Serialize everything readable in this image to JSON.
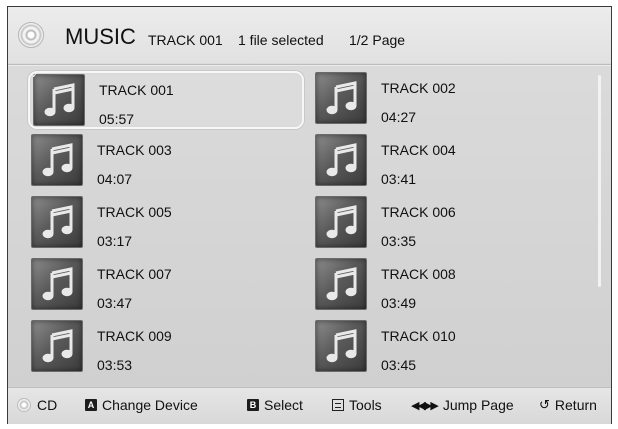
{
  "header": {
    "title": "MUSIC",
    "current_track": "TRACK 001",
    "selection_status": "1 file selected",
    "page_indicator": "1/2 Page"
  },
  "tracks": [
    {
      "name": "TRACK 001",
      "duration": "05:57",
      "selected": true
    },
    {
      "name": "TRACK 002",
      "duration": "04:27"
    },
    {
      "name": "TRACK 003",
      "duration": "04:07"
    },
    {
      "name": "TRACK 004",
      "duration": "03:41"
    },
    {
      "name": "TRACK 005",
      "duration": "03:17"
    },
    {
      "name": "TRACK 006",
      "duration": "03:35"
    },
    {
      "name": "TRACK 007",
      "duration": "03:47"
    },
    {
      "name": "TRACK 008",
      "duration": "03:49"
    },
    {
      "name": "TRACK 009",
      "duration": "03:53"
    },
    {
      "name": "TRACK 010",
      "duration": "03:45"
    }
  ],
  "footer": {
    "device": "CD",
    "change_device": {
      "key": "A",
      "label": "Change Device"
    },
    "select": {
      "key": "B",
      "label": "Select"
    },
    "tools": {
      "label": "Tools"
    },
    "jump_page": {
      "label": "Jump Page"
    },
    "return": {
      "label": "Return"
    }
  },
  "icons": {
    "header": "disc-icon",
    "thumbnail": "music-note-icon",
    "check": "check-icon",
    "tools": "tools-icon",
    "jump": "jump-arrows-icon",
    "return": "return-icon"
  }
}
